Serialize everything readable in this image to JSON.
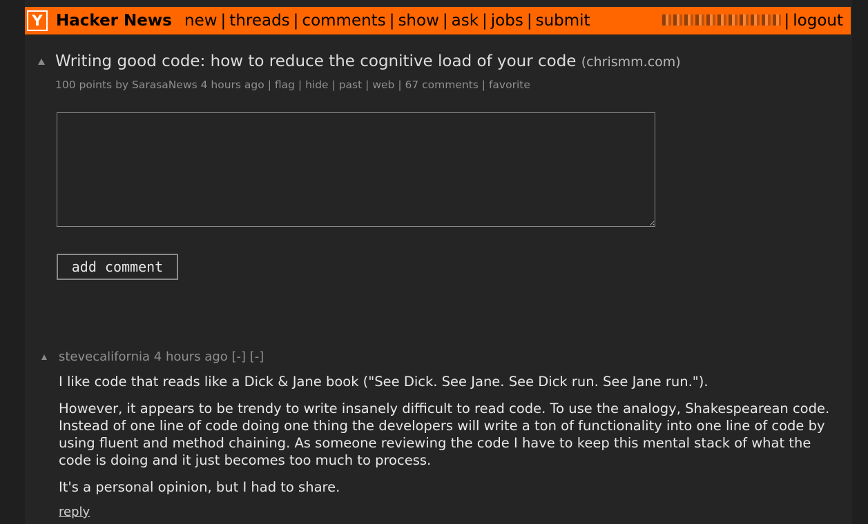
{
  "header": {
    "logo_letter": "Y",
    "site_name": "Hacker News",
    "nav": [
      "new",
      "threads",
      "comments",
      "show",
      "ask",
      "jobs",
      "submit"
    ],
    "logout_label": "logout",
    "accent_color": "#ff6600"
  },
  "story": {
    "title": "Writing good code: how to reduce the cognitive load of your code",
    "domain": "(chrismm.com)",
    "points": "100 points",
    "by_label": "by",
    "author": "SarasaNews",
    "age": "4 hours ago",
    "actions": [
      "flag",
      "hide",
      "past",
      "web",
      "67 comments",
      "favorite"
    ]
  },
  "comment_form": {
    "textarea_value": "",
    "submit_label": "add comment"
  },
  "comments": [
    {
      "author": "stevecalifornia",
      "age": "4 hours ago",
      "toggle_1": "[-]",
      "toggle_2": "[-]",
      "paragraphs": [
        "I like code that reads like a Dick & Jane book (\"See Dick. See Jane. See Dick run. See Jane run.\").",
        "However, it appears to be trendy to write insanely difficult to read code. To use the analogy, Shakespearean code. Instead of one line of code doing one thing the developers will write a ton of functionality into one line of code by using fluent and method chaining. As someone reviewing the code I have to keep this mental stack of what the code is doing and it just becomes too much to process.",
        "It's a personal opinion, but I had to share."
      ],
      "reply_label": "reply"
    }
  ]
}
